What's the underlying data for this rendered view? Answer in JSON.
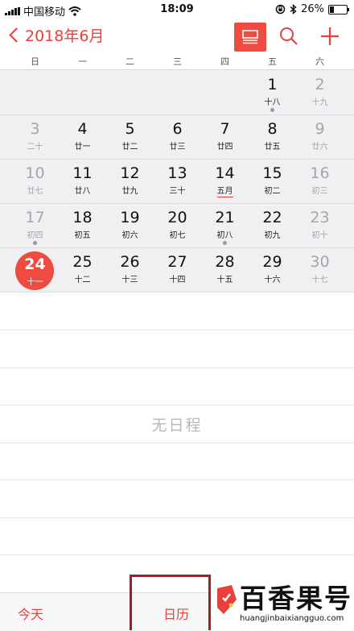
{
  "status_bar": {
    "carrier": "中国移动",
    "time": "18:09",
    "battery": "26%",
    "battery_level": 0.26
  },
  "header": {
    "back_label": "2018年6月",
    "list_icon": "list-view-icon",
    "search_icon": "search-icon",
    "add_icon": "plus-icon",
    "accent_color": "#e8403a"
  },
  "weekdays": [
    "日",
    "一",
    "二",
    "三",
    "四",
    "五",
    "六"
  ],
  "calendar": {
    "weeks": [
      [
        {
          "day": "",
          "lunar": ""
        },
        {
          "day": "",
          "lunar": ""
        },
        {
          "day": "",
          "lunar": ""
        },
        {
          "day": "",
          "lunar": ""
        },
        {
          "day": "",
          "lunar": ""
        },
        {
          "day": "1",
          "lunar": "十八",
          "dot": true
        },
        {
          "day": "2",
          "lunar": "十九"
        }
      ],
      [
        {
          "day": "3",
          "lunar": "二十"
        },
        {
          "day": "4",
          "lunar": "廿一"
        },
        {
          "day": "5",
          "lunar": "廿二"
        },
        {
          "day": "6",
          "lunar": "廿三"
        },
        {
          "day": "7",
          "lunar": "廿四"
        },
        {
          "day": "8",
          "lunar": "廿五"
        },
        {
          "day": "9",
          "lunar": "廿六"
        }
      ],
      [
        {
          "day": "10",
          "lunar": "廿七"
        },
        {
          "day": "11",
          "lunar": "廿八"
        },
        {
          "day": "12",
          "lunar": "廿九"
        },
        {
          "day": "13",
          "lunar": "三十"
        },
        {
          "day": "14",
          "lunar": "五月",
          "highlight": true
        },
        {
          "day": "15",
          "lunar": "初二"
        },
        {
          "day": "16",
          "lunar": "初三"
        }
      ],
      [
        {
          "day": "17",
          "lunar": "初四",
          "dot": true
        },
        {
          "day": "18",
          "lunar": "初五"
        },
        {
          "day": "19",
          "lunar": "初六"
        },
        {
          "day": "20",
          "lunar": "初七"
        },
        {
          "day": "21",
          "lunar": "初八",
          "dot": true
        },
        {
          "day": "22",
          "lunar": "初九"
        },
        {
          "day": "23",
          "lunar": "初十"
        }
      ],
      [
        {
          "day": "24",
          "lunar": "十一",
          "selected": true
        },
        {
          "day": "25",
          "lunar": "十二"
        },
        {
          "day": "26",
          "lunar": "十三"
        },
        {
          "day": "27",
          "lunar": "十四"
        },
        {
          "day": "28",
          "lunar": "十五"
        },
        {
          "day": "29",
          "lunar": "十六"
        },
        {
          "day": "30",
          "lunar": "十七"
        }
      ]
    ]
  },
  "events": {
    "empty_text": "无日程"
  },
  "toolbar": {
    "today_label": "今天",
    "calendars_label": "日历"
  },
  "watermark": {
    "brand": "百香果号",
    "url": "huangjinbaixiangguo.com"
  }
}
